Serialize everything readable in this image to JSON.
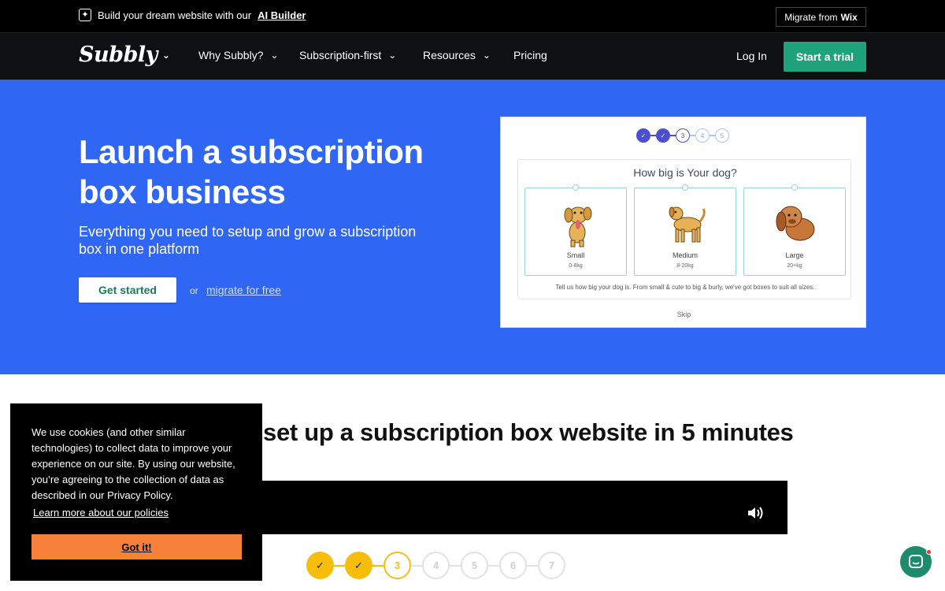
{
  "promo": {
    "text": "Build your dream website with our",
    "link": "AI Builder",
    "migrate_prefix": "Migrate from",
    "migrate_brand": "Wix"
  },
  "nav": {
    "logo": "Subbly",
    "items": [
      {
        "label": "Why Subbly?",
        "has_dropdown": true
      },
      {
        "label": "Subscription-first",
        "has_dropdown": true
      },
      {
        "label": "Resources",
        "has_dropdown": true
      },
      {
        "label": "Pricing",
        "has_dropdown": false
      }
    ],
    "login": "Log In",
    "cta": "Start a trial"
  },
  "hero": {
    "title": "Launch a subscription box business",
    "subtitle": "Everything you need to setup and grow a subscription box in one platform",
    "primary_cta": "Get started",
    "or": "or",
    "secondary_cta": "migrate for free",
    "preview": {
      "steps": [
        "3",
        "4",
        "5"
      ],
      "question": "How big is Your dog?",
      "options": [
        {
          "name": "Small",
          "weight": "0-8kg"
        },
        {
          "name": "Medium",
          "weight": "8-20kg"
        },
        {
          "name": "Large",
          "weight": "20+kg"
        }
      ],
      "note": "Tell us how big your dog is. From small & cute to big & burly, we've got boxes to suit all sizes.",
      "skip": "Skip"
    }
  },
  "section": {
    "title": "set up a subscription box website in 5 minutes"
  },
  "steps": [
    "3",
    "4",
    "5",
    "6",
    "7"
  ],
  "cookie": {
    "text": "We use cookies (and other similar technologies) to collect data to improve your experience on our site. By using our website, you’re agreeing to the collection of data as described in our Privacy Policy.",
    "link": "Learn more about our policies",
    "button": "Got it!"
  },
  "colors": {
    "hero_bg": "#2f66f3",
    "cta_green": "#1ea37c",
    "step_yellow": "#f7bd0d",
    "cookie_button": "#f7813b"
  }
}
